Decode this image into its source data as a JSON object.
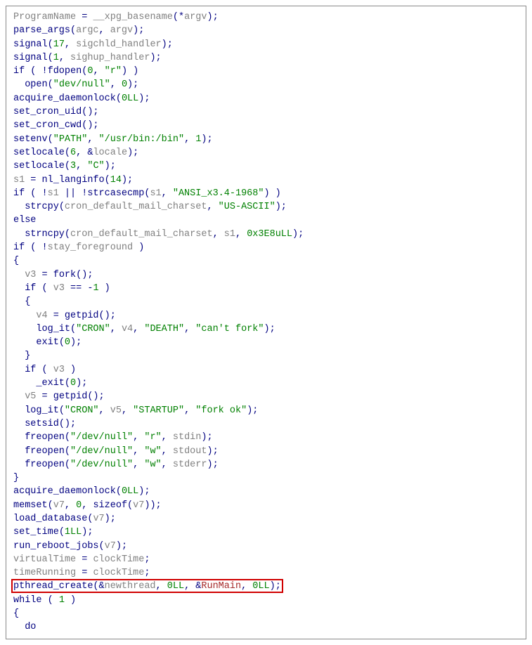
{
  "code_lines": [
    {
      "parts": [
        {
          "t": "id",
          "v": "ProgramName"
        },
        {
          "t": "op",
          "v": " = "
        },
        {
          "t": "id",
          "v": "__xpg_basename"
        },
        {
          "t": "op",
          "v": "(*"
        },
        {
          "t": "id",
          "v": "argv"
        },
        {
          "t": "op",
          "v": ");"
        }
      ]
    },
    {
      "parts": [
        {
          "t": "fn",
          "v": "parse_args"
        },
        {
          "t": "op",
          "v": "("
        },
        {
          "t": "id",
          "v": "argc"
        },
        {
          "t": "op",
          "v": ", "
        },
        {
          "t": "id",
          "v": "argv"
        },
        {
          "t": "op",
          "v": ");"
        }
      ]
    },
    {
      "parts": [
        {
          "t": "fn",
          "v": "signal"
        },
        {
          "t": "op",
          "v": "("
        },
        {
          "t": "num",
          "v": "17"
        },
        {
          "t": "op",
          "v": ", "
        },
        {
          "t": "id",
          "v": "sigchld_handler"
        },
        {
          "t": "op",
          "v": ");"
        }
      ]
    },
    {
      "parts": [
        {
          "t": "fn",
          "v": "signal"
        },
        {
          "t": "op",
          "v": "("
        },
        {
          "t": "num",
          "v": "1"
        },
        {
          "t": "op",
          "v": ", "
        },
        {
          "t": "id",
          "v": "sighup_handler"
        },
        {
          "t": "op",
          "v": ");"
        }
      ]
    },
    {
      "parts": [
        {
          "t": "kw",
          "v": "if"
        },
        {
          "t": "op",
          "v": " ( !"
        },
        {
          "t": "fn",
          "v": "fdopen"
        },
        {
          "t": "op",
          "v": "("
        },
        {
          "t": "num",
          "v": "0"
        },
        {
          "t": "op",
          "v": ", "
        },
        {
          "t": "str",
          "v": "\"r\""
        },
        {
          "t": "op",
          "v": ") )"
        }
      ]
    },
    {
      "indent": 1,
      "parts": [
        {
          "t": "fn",
          "v": "open"
        },
        {
          "t": "op",
          "v": "("
        },
        {
          "t": "str",
          "v": "\"dev/null\""
        },
        {
          "t": "op",
          "v": ", "
        },
        {
          "t": "num",
          "v": "0"
        },
        {
          "t": "op",
          "v": ");"
        }
      ]
    },
    {
      "parts": [
        {
          "t": "fn",
          "v": "acquire_daemonlock"
        },
        {
          "t": "op",
          "v": "("
        },
        {
          "t": "num",
          "v": "0LL"
        },
        {
          "t": "op",
          "v": ");"
        }
      ]
    },
    {
      "parts": [
        {
          "t": "fn",
          "v": "set_cron_uid"
        },
        {
          "t": "op",
          "v": "();"
        }
      ]
    },
    {
      "parts": [
        {
          "t": "fn",
          "v": "set_cron_cwd"
        },
        {
          "t": "op",
          "v": "();"
        }
      ]
    },
    {
      "parts": [
        {
          "t": "fn",
          "v": "setenv"
        },
        {
          "t": "op",
          "v": "("
        },
        {
          "t": "str",
          "v": "\"PATH\""
        },
        {
          "t": "op",
          "v": ", "
        },
        {
          "t": "str",
          "v": "\"/usr/bin:/bin\""
        },
        {
          "t": "op",
          "v": ", "
        },
        {
          "t": "num",
          "v": "1"
        },
        {
          "t": "op",
          "v": ");"
        }
      ]
    },
    {
      "parts": [
        {
          "t": "fn",
          "v": "setlocale"
        },
        {
          "t": "op",
          "v": "("
        },
        {
          "t": "num",
          "v": "6"
        },
        {
          "t": "op",
          "v": ", &"
        },
        {
          "t": "id",
          "v": "locale"
        },
        {
          "t": "op",
          "v": ");"
        }
      ]
    },
    {
      "parts": [
        {
          "t": "fn",
          "v": "setlocale"
        },
        {
          "t": "op",
          "v": "("
        },
        {
          "t": "num",
          "v": "3"
        },
        {
          "t": "op",
          "v": ", "
        },
        {
          "t": "str",
          "v": "\"C\""
        },
        {
          "t": "op",
          "v": ");"
        }
      ]
    },
    {
      "parts": [
        {
          "t": "id",
          "v": "s1"
        },
        {
          "t": "op",
          "v": " = "
        },
        {
          "t": "fn",
          "v": "nl_langinfo"
        },
        {
          "t": "op",
          "v": "("
        },
        {
          "t": "num",
          "v": "14"
        },
        {
          "t": "op",
          "v": ");"
        }
      ]
    },
    {
      "parts": [
        {
          "t": "kw",
          "v": "if"
        },
        {
          "t": "op",
          "v": " ( !"
        },
        {
          "t": "id",
          "v": "s1"
        },
        {
          "t": "op",
          "v": " || !"
        },
        {
          "t": "fn",
          "v": "strcasecmp"
        },
        {
          "t": "op",
          "v": "("
        },
        {
          "t": "id",
          "v": "s1"
        },
        {
          "t": "op",
          "v": ", "
        },
        {
          "t": "str",
          "v": "\"ANSI_x3.4-1968\""
        },
        {
          "t": "op",
          "v": ") )"
        }
      ]
    },
    {
      "indent": 1,
      "parts": [
        {
          "t": "fn",
          "v": "strcpy"
        },
        {
          "t": "op",
          "v": "("
        },
        {
          "t": "id",
          "v": "cron_default_mail_charset"
        },
        {
          "t": "op",
          "v": ", "
        },
        {
          "t": "str",
          "v": "\"US-ASCII\""
        },
        {
          "t": "op",
          "v": ");"
        }
      ]
    },
    {
      "parts": [
        {
          "t": "kw",
          "v": "else"
        }
      ]
    },
    {
      "indent": 1,
      "parts": [
        {
          "t": "fn",
          "v": "strncpy"
        },
        {
          "t": "op",
          "v": "("
        },
        {
          "t": "id",
          "v": "cron_default_mail_charset"
        },
        {
          "t": "op",
          "v": ", "
        },
        {
          "t": "id",
          "v": "s1"
        },
        {
          "t": "op",
          "v": ", "
        },
        {
          "t": "num",
          "v": "0x3E8uLL"
        },
        {
          "t": "op",
          "v": ");"
        }
      ]
    },
    {
      "parts": [
        {
          "t": "kw",
          "v": "if"
        },
        {
          "t": "op",
          "v": " ( !"
        },
        {
          "t": "id",
          "v": "stay_foreground"
        },
        {
          "t": "op",
          "v": " )"
        }
      ]
    },
    {
      "parts": [
        {
          "t": "op",
          "v": "{"
        }
      ]
    },
    {
      "indent": 1,
      "parts": [
        {
          "t": "id",
          "v": "v3"
        },
        {
          "t": "op",
          "v": " = "
        },
        {
          "t": "fn",
          "v": "fork"
        },
        {
          "t": "op",
          "v": "();"
        }
      ]
    },
    {
      "indent": 1,
      "parts": [
        {
          "t": "kw",
          "v": "if"
        },
        {
          "t": "op",
          "v": " ( "
        },
        {
          "t": "id",
          "v": "v3"
        },
        {
          "t": "op",
          "v": " == -"
        },
        {
          "t": "num",
          "v": "1"
        },
        {
          "t": "op",
          "v": " )"
        }
      ]
    },
    {
      "indent": 1,
      "parts": [
        {
          "t": "op",
          "v": "{"
        }
      ]
    },
    {
      "indent": 2,
      "parts": [
        {
          "t": "id",
          "v": "v4"
        },
        {
          "t": "op",
          "v": " = "
        },
        {
          "t": "fn",
          "v": "getpid"
        },
        {
          "t": "op",
          "v": "();"
        }
      ]
    },
    {
      "indent": 2,
      "parts": [
        {
          "t": "fn",
          "v": "log_it"
        },
        {
          "t": "op",
          "v": "("
        },
        {
          "t": "str",
          "v": "\"CRON\""
        },
        {
          "t": "op",
          "v": ", "
        },
        {
          "t": "id",
          "v": "v4"
        },
        {
          "t": "op",
          "v": ", "
        },
        {
          "t": "str",
          "v": "\"DEATH\""
        },
        {
          "t": "op",
          "v": ", "
        },
        {
          "t": "str",
          "v": "\"can't fork\""
        },
        {
          "t": "op",
          "v": ");"
        }
      ]
    },
    {
      "indent": 2,
      "parts": [
        {
          "t": "fn",
          "v": "exit"
        },
        {
          "t": "op",
          "v": "("
        },
        {
          "t": "num",
          "v": "0"
        },
        {
          "t": "op",
          "v": ");"
        }
      ]
    },
    {
      "indent": 1,
      "parts": [
        {
          "t": "op",
          "v": "}"
        }
      ]
    },
    {
      "indent": 1,
      "parts": [
        {
          "t": "kw",
          "v": "if"
        },
        {
          "t": "op",
          "v": " ( "
        },
        {
          "t": "id",
          "v": "v3"
        },
        {
          "t": "op",
          "v": " )"
        }
      ]
    },
    {
      "indent": 2,
      "parts": [
        {
          "t": "fn",
          "v": "_exit"
        },
        {
          "t": "op",
          "v": "("
        },
        {
          "t": "num",
          "v": "0"
        },
        {
          "t": "op",
          "v": ");"
        }
      ]
    },
    {
      "indent": 1,
      "parts": [
        {
          "t": "id",
          "v": "v5"
        },
        {
          "t": "op",
          "v": " = "
        },
        {
          "t": "fn",
          "v": "getpid"
        },
        {
          "t": "op",
          "v": "();"
        }
      ]
    },
    {
      "indent": 1,
      "parts": [
        {
          "t": "fn",
          "v": "log_it"
        },
        {
          "t": "op",
          "v": "("
        },
        {
          "t": "str",
          "v": "\"CRON\""
        },
        {
          "t": "op",
          "v": ", "
        },
        {
          "t": "id",
          "v": "v5"
        },
        {
          "t": "op",
          "v": ", "
        },
        {
          "t": "str",
          "v": "\"STARTUP\""
        },
        {
          "t": "op",
          "v": ", "
        },
        {
          "t": "str",
          "v": "\"fork ok\""
        },
        {
          "t": "op",
          "v": ");"
        }
      ]
    },
    {
      "indent": 1,
      "parts": [
        {
          "t": "fn",
          "v": "setsid"
        },
        {
          "t": "op",
          "v": "();"
        }
      ]
    },
    {
      "indent": 1,
      "parts": [
        {
          "t": "fn",
          "v": "freopen"
        },
        {
          "t": "op",
          "v": "("
        },
        {
          "t": "str",
          "v": "\"/dev/null\""
        },
        {
          "t": "op",
          "v": ", "
        },
        {
          "t": "str",
          "v": "\"r\""
        },
        {
          "t": "op",
          "v": ", "
        },
        {
          "t": "id",
          "v": "stdin"
        },
        {
          "t": "op",
          "v": ");"
        }
      ]
    },
    {
      "indent": 1,
      "parts": [
        {
          "t": "fn",
          "v": "freopen"
        },
        {
          "t": "op",
          "v": "("
        },
        {
          "t": "str",
          "v": "\"/dev/null\""
        },
        {
          "t": "op",
          "v": ", "
        },
        {
          "t": "str",
          "v": "\"w\""
        },
        {
          "t": "op",
          "v": ", "
        },
        {
          "t": "id",
          "v": "stdout"
        },
        {
          "t": "op",
          "v": ");"
        }
      ]
    },
    {
      "indent": 1,
      "parts": [
        {
          "t": "fn",
          "v": "freopen"
        },
        {
          "t": "op",
          "v": "("
        },
        {
          "t": "str",
          "v": "\"/dev/null\""
        },
        {
          "t": "op",
          "v": ", "
        },
        {
          "t": "str",
          "v": "\"w\""
        },
        {
          "t": "op",
          "v": ", "
        },
        {
          "t": "id",
          "v": "stderr"
        },
        {
          "t": "op",
          "v": ");"
        }
      ]
    },
    {
      "parts": [
        {
          "t": "op",
          "v": "}"
        }
      ]
    },
    {
      "parts": [
        {
          "t": "fn",
          "v": "acquire_daemonlock"
        },
        {
          "t": "op",
          "v": "("
        },
        {
          "t": "num",
          "v": "0LL"
        },
        {
          "t": "op",
          "v": ");"
        }
      ]
    },
    {
      "parts": [
        {
          "t": "fn",
          "v": "memset"
        },
        {
          "t": "op",
          "v": "("
        },
        {
          "t": "id",
          "v": "v7"
        },
        {
          "t": "op",
          "v": ", "
        },
        {
          "t": "num",
          "v": "0"
        },
        {
          "t": "op",
          "v": ", "
        },
        {
          "t": "fn",
          "v": "sizeof"
        },
        {
          "t": "op",
          "v": "("
        },
        {
          "t": "id",
          "v": "v7"
        },
        {
          "t": "op",
          "v": "));"
        }
      ]
    },
    {
      "parts": [
        {
          "t": "fn",
          "v": "load_database"
        },
        {
          "t": "op",
          "v": "("
        },
        {
          "t": "id",
          "v": "v7"
        },
        {
          "t": "op",
          "v": ");"
        }
      ]
    },
    {
      "parts": [
        {
          "t": "fn",
          "v": "set_time"
        },
        {
          "t": "op",
          "v": "("
        },
        {
          "t": "num",
          "v": "1LL"
        },
        {
          "t": "op",
          "v": ");"
        }
      ]
    },
    {
      "parts": [
        {
          "t": "fn",
          "v": "run_reboot_jobs"
        },
        {
          "t": "op",
          "v": "("
        },
        {
          "t": "id",
          "v": "v7"
        },
        {
          "t": "op",
          "v": ");"
        }
      ]
    },
    {
      "parts": [
        {
          "t": "id",
          "v": "virtualTime"
        },
        {
          "t": "op",
          "v": " = "
        },
        {
          "t": "id",
          "v": "clockTime"
        },
        {
          "t": "op",
          "v": ";"
        }
      ]
    },
    {
      "parts": [
        {
          "t": "id",
          "v": "timeRunning"
        },
        {
          "t": "op",
          "v": " = "
        },
        {
          "t": "id",
          "v": "clockTime"
        },
        {
          "t": "op",
          "v": ";"
        }
      ]
    },
    {
      "highlighted": true,
      "parts": [
        {
          "t": "fn",
          "v": "pthread_create"
        },
        {
          "t": "op",
          "v": "(&"
        },
        {
          "t": "id",
          "v": "newthread"
        },
        {
          "t": "op",
          "v": ", "
        },
        {
          "t": "num",
          "v": "0LL"
        },
        {
          "t": "op",
          "v": ", &"
        },
        {
          "t": "run",
          "v": "RunMain"
        },
        {
          "t": "op",
          "v": ", "
        },
        {
          "t": "num",
          "v": "0LL"
        },
        {
          "t": "op",
          "v": ");"
        }
      ]
    },
    {
      "parts": [
        {
          "t": "kw",
          "v": "while"
        },
        {
          "t": "op",
          "v": " ( "
        },
        {
          "t": "num",
          "v": "1"
        },
        {
          "t": "op",
          "v": " )"
        }
      ]
    },
    {
      "parts": [
        {
          "t": "op",
          "v": "{"
        }
      ]
    },
    {
      "indent": 1,
      "parts": [
        {
          "t": "kw",
          "v": "do"
        }
      ]
    }
  ]
}
